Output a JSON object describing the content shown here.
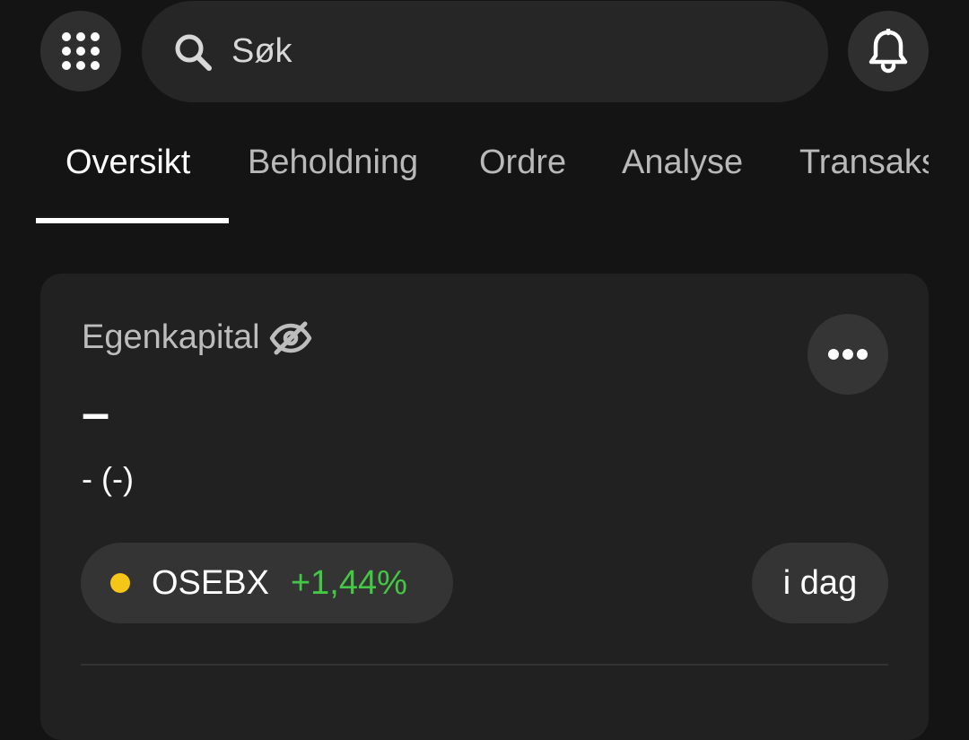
{
  "header": {
    "search_placeholder": "Søk"
  },
  "tabs": [
    {
      "label": "Oversikt",
      "active": true
    },
    {
      "label": "Beholdning",
      "active": false
    },
    {
      "label": "Ordre",
      "active": false
    },
    {
      "label": "Analyse",
      "active": false
    },
    {
      "label": "Transaksjoner",
      "active": false
    }
  ],
  "equity": {
    "label": "Egenkapital",
    "value": "–",
    "change": "- (-)"
  },
  "index": {
    "name": "OSEBX",
    "change": "+1,44%",
    "dot_color": "#f5c518",
    "change_color": "#44c744"
  },
  "period": {
    "label": "i dag"
  },
  "icons": {
    "menu": "grid-icon",
    "search": "search-icon",
    "notifications": "bell-icon",
    "hide_balance": "eye-off-icon",
    "more": "ellipsis-icon"
  }
}
